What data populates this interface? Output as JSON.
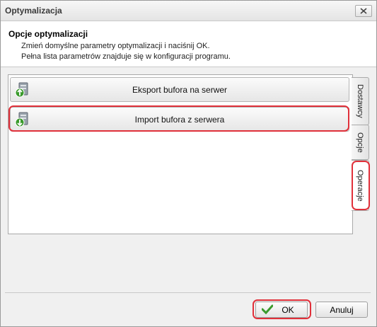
{
  "window": {
    "title": "Optymalizacja"
  },
  "header": {
    "title": "Opcje optymalizacji",
    "line1": "Zmień domyślne parametry optymalizacji i naciśnij OK.",
    "line2": "Pełna lista parametrów znajduje się w konfiguracji programu."
  },
  "operations": [
    {
      "label": "Eksport bufora na serwer",
      "icon": "server-upload-icon"
    },
    {
      "label": "Import bufora z serwera",
      "icon": "server-download-icon"
    }
  ],
  "tabs": [
    {
      "label": "Dostawcy"
    },
    {
      "label": "Opcje"
    },
    {
      "label": "Operacje",
      "active": true
    }
  ],
  "footer": {
    "ok_label": "OK",
    "cancel_label": "Anuluj"
  },
  "colors": {
    "highlight": "#e0303a",
    "accent_green": "#3a9a2c"
  }
}
